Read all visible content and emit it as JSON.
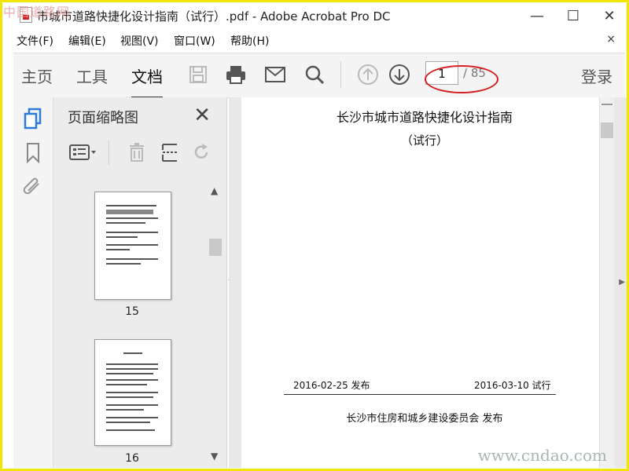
{
  "window": {
    "title": "市城市道路快捷化设计指南（试行）.pdf - Adobe Acrobat Pro DC",
    "minimize": "—",
    "maximize": "☐",
    "close": "✕"
  },
  "menu": {
    "items": [
      "文件(F)",
      "编辑(E)",
      "视图(V)",
      "窗口(W)",
      "帮助(H)"
    ],
    "close": "×"
  },
  "toolbar": {
    "tabs": [
      "主页",
      "工具",
      "文档"
    ],
    "active_tab": "文档",
    "page_current": "1",
    "page_total": "/ 85",
    "login": "登录"
  },
  "panel": {
    "title": "页面缩略图",
    "close": "✕",
    "thumbnails": [
      {
        "label": "15"
      },
      {
        "label": "16"
      }
    ]
  },
  "document": {
    "title": "长沙市城市道路快捷化设计指南",
    "subtitle": "（试行）",
    "date_left": "2016-02-25   发布",
    "date_right": "2016-03-10  试行",
    "issuer": "长沙市住房和城乡建设委员会   发布"
  },
  "watermarks": {
    "cn": "中国道路网",
    "url": "www.cndao.com"
  },
  "colors": {
    "accent_red": "#d61c1c",
    "border_yellow": "#f2e600",
    "toolbar_bg": "#f4f4f4"
  }
}
